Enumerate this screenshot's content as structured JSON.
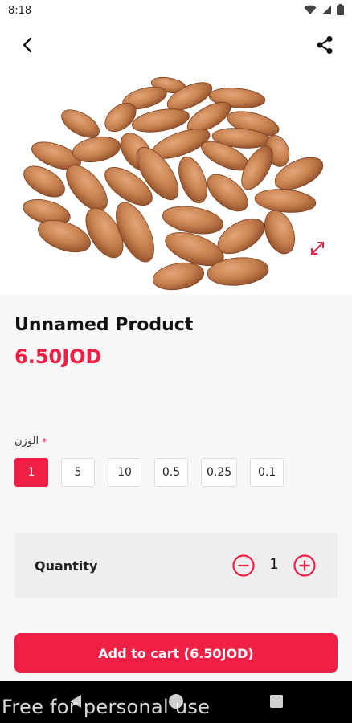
{
  "status_bar": {
    "time": "8:18"
  },
  "app_bar": {
    "back_icon": "arrow-back-icon",
    "share_icon": "share-icon"
  },
  "product": {
    "title": "Unnamed Product",
    "price": "6.50JOD",
    "image_alt": "almonds",
    "expand_icon": "expand-icon"
  },
  "option_group": {
    "label": "الوزن",
    "required_mark": "*",
    "options": [
      "1",
      "5",
      "10",
      "0.5",
      "0.25",
      "0.1"
    ],
    "selected": "1"
  },
  "quantity": {
    "label": "Quantity",
    "value": "1",
    "minus_icon": "minus-circle-icon",
    "plus_icon": "plus-circle-icon"
  },
  "cart_button": {
    "label": "Add to cart (6.50JOD)"
  },
  "colors": {
    "accent": "#ef1f45",
    "background": "#f7f7f8",
    "card": "#efeff2"
  },
  "watermark": "Free for personal use"
}
